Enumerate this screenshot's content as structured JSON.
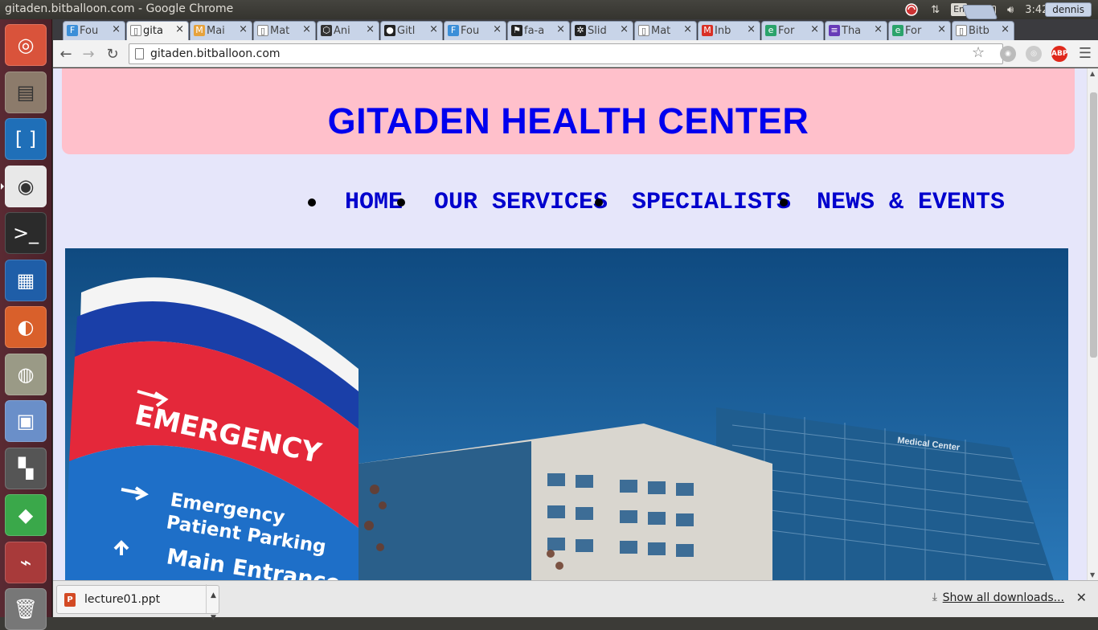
{
  "os_bar": {
    "window_title": "gitaden.bitballoon.com - Google Chrome",
    "keyboard_layout": "En",
    "time": "3:42 WB"
  },
  "launcher": {
    "items": [
      {
        "name": "ubuntu-dash",
        "icon": "ubuntu-logo-icon",
        "color": "#d9533b"
      },
      {
        "name": "files",
        "icon": "file-cabinet-icon",
        "color": "#8c7b6b"
      },
      {
        "name": "brackets",
        "icon": "brackets-icon",
        "color": "#1f6fb8"
      },
      {
        "name": "chrome",
        "icon": "chrome-icon",
        "color": "#e8e8e8"
      },
      {
        "name": "terminal",
        "icon": "terminal-icon",
        "color": "#2b2b2b"
      },
      {
        "name": "writer",
        "icon": "document-icon",
        "color": "#1f5ea8"
      },
      {
        "name": "firefox",
        "icon": "firefox-icon",
        "color": "#d9602b"
      },
      {
        "name": "speaker",
        "icon": "speaker-icon",
        "color": "#9a9a86"
      },
      {
        "name": "virtualbox",
        "icon": "cube-icon",
        "color": "#6a8fc9"
      },
      {
        "name": "video-editor",
        "icon": "clapper-icon",
        "color": "#555555"
      },
      {
        "name": "color-cube",
        "icon": "rgb-cube-icon",
        "color": "#3aa84a"
      },
      {
        "name": "usb",
        "icon": "usb-icon",
        "color": "#a83a3a"
      },
      {
        "name": "trash",
        "icon": "trash-icon",
        "color": "#777777"
      }
    ]
  },
  "tabs": [
    {
      "label": "Fou",
      "icon": "F",
      "color": "#3c8fd8"
    },
    {
      "label": "gita",
      "icon": "page",
      "color": "#ffffff",
      "active": true
    },
    {
      "label": "Mai",
      "icon": "M",
      "color": "#e6a23c"
    },
    {
      "label": "Mat",
      "icon": "page",
      "color": "#ffffff"
    },
    {
      "label": "Ani",
      "icon": "codepen",
      "color": "#333333"
    },
    {
      "label": "Gitl",
      "icon": "github",
      "color": "#222222"
    },
    {
      "label": "Fou",
      "icon": "F",
      "color": "#3c8fd8"
    },
    {
      "label": "fa-a",
      "icon": "flag",
      "color": "#222222"
    },
    {
      "label": "Slid",
      "icon": "gear",
      "color": "#222222"
    },
    {
      "label": "Mat",
      "icon": "page",
      "color": "#ffffff"
    },
    {
      "label": "Inb",
      "icon": "M",
      "color": "#d93025"
    },
    {
      "label": "For",
      "icon": "e",
      "color": "#2ba36b"
    },
    {
      "label": "Tha",
      "icon": "list",
      "color": "#673ab7"
    },
    {
      "label": "For",
      "icon": "e",
      "color": "#2ba36b"
    },
    {
      "label": "Bitb",
      "icon": "page",
      "color": "#ffffff"
    }
  ],
  "profile_name": "dennis",
  "toolbar": {
    "url": "gitaden.bitballoon.com",
    "adblock_label": "ABP"
  },
  "page": {
    "site_title": "GITADEN HEALTH CENTER",
    "nav": [
      "HOME",
      "OUR SERVICES",
      "SPECIALISTS",
      "NEWS & EVENTS"
    ],
    "hero": {
      "sign_main": "EMERGENCY",
      "sign_sub1": "Emergency",
      "sign_sub2": "Patient Parking",
      "sign_sub3": "Main Entrance",
      "building_label": "Medical Center"
    },
    "colors": {
      "background": "#e6e6fa",
      "banner": "#ffc0cb",
      "title": "#0000ee",
      "nav": "#0000cd"
    }
  },
  "downloads": {
    "file_name": "lecture01.ppt",
    "show_all": "Show all downloads..."
  }
}
